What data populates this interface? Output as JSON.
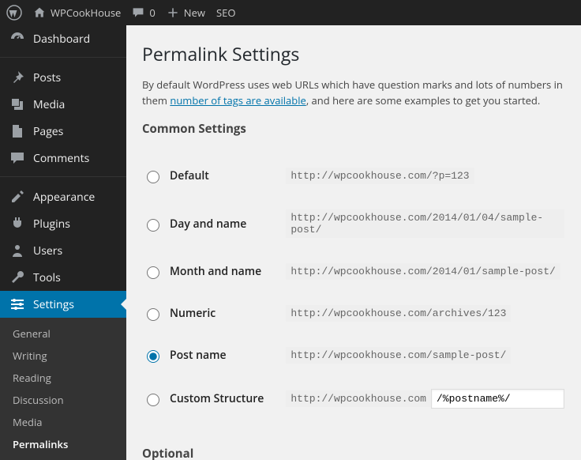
{
  "adminbar": {
    "site_name": "WPCookHouse",
    "comments_count": "0",
    "new_label": "New",
    "seo_label": "SEO"
  },
  "sidebar": {
    "dashboard": "Dashboard",
    "posts": "Posts",
    "media": "Media",
    "pages": "Pages",
    "comments": "Comments",
    "appearance": "Appearance",
    "plugins": "Plugins",
    "users": "Users",
    "tools": "Tools",
    "settings": "Settings",
    "sub": {
      "general": "General",
      "writing": "Writing",
      "reading": "Reading",
      "discussion": "Discussion",
      "media": "Media",
      "permalinks": "Permalinks"
    }
  },
  "page": {
    "title": "Permalink Settings",
    "intro_before": "By default WordPress uses web URLs which have question marks and lots of numbers in them",
    "intro_link": "number of tags are available",
    "intro_after": ", and here are some examples to get you started.",
    "common_heading": "Common Settings",
    "optional_heading": "Optional",
    "options": {
      "default": {
        "label": "Default",
        "example": "http://wpcookhouse.com/?p=123"
      },
      "dayname": {
        "label": "Day and name",
        "example": "http://wpcookhouse.com/2014/01/04/sample-post/"
      },
      "monthname": {
        "label": "Month and name",
        "example": "http://wpcookhouse.com/2014/01/sample-post/"
      },
      "numeric": {
        "label": "Numeric",
        "example": "http://wpcookhouse.com/archives/123"
      },
      "postname": {
        "label": "Post name",
        "example": "http://wpcookhouse.com/sample-post/"
      },
      "custom": {
        "label": "Custom Structure",
        "prefix": "http://wpcookhouse.com",
        "value": "/%postname%/"
      }
    }
  }
}
